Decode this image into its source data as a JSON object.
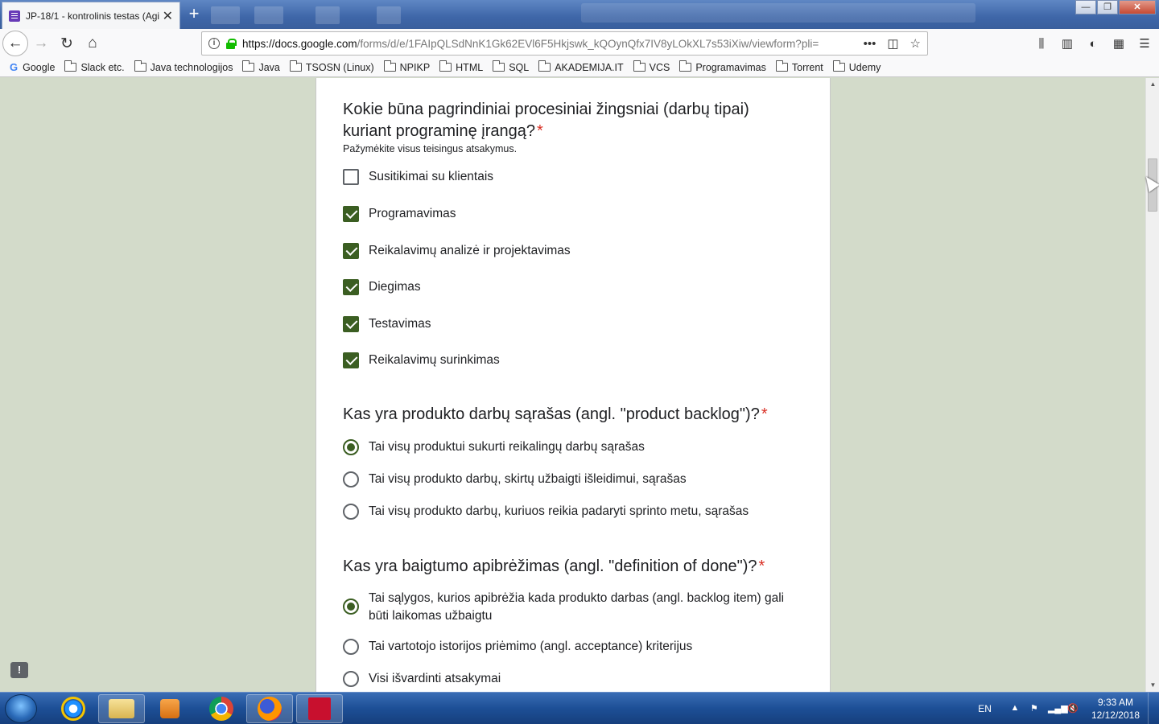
{
  "browser": {
    "tab_title": "JP-18/1 - kontrolinis testas (Agi",
    "tab_close": "✕",
    "new_tab": "+",
    "url_host": "https://docs.google.com",
    "url_path": "/forms/d/e/1FAIpQLSdNnK1Gk62EVl6F5Hkjswk_kQOynQfx7IV8yLOkXL7s53iXiw/viewform?pli=",
    "page_actions_icon": "•••"
  },
  "bookmarks": [
    {
      "label": "Google",
      "icon": "google-icon"
    },
    {
      "label": "Slack etc.",
      "icon": "folder-icon"
    },
    {
      "label": "Java technologijos",
      "icon": "folder-icon"
    },
    {
      "label": "Java",
      "icon": "folder-icon"
    },
    {
      "label": "TSOSN (Linux)",
      "icon": "folder-icon"
    },
    {
      "label": "NPIKP",
      "icon": "folder-icon"
    },
    {
      "label": "HTML",
      "icon": "folder-icon"
    },
    {
      "label": "SQL",
      "icon": "folder-icon"
    },
    {
      "label": "AKADEMIJA.IT",
      "icon": "folder-icon"
    },
    {
      "label": "VCS",
      "icon": "folder-icon"
    },
    {
      "label": "Programavimas",
      "icon": "folder-icon"
    },
    {
      "label": "Torrent",
      "icon": "folder-icon"
    },
    {
      "label": "Udemy",
      "icon": "folder-icon"
    }
  ],
  "form": {
    "required_mark": "*",
    "q1": {
      "title": "Kokie būna pagrindiniai procesiniai žingsniai (darbų tipai) kuriant programinę įrangą?",
      "hint": "Pažymėkite visus teisingus atsakymus.",
      "options": [
        {
          "label": "Susitikimai su klientais",
          "checked": false
        },
        {
          "label": "Programavimas",
          "checked": true
        },
        {
          "label": "Reikalavimų analizė ir projektavimas",
          "checked": true
        },
        {
          "label": "Diegimas",
          "checked": true
        },
        {
          "label": "Testavimas",
          "checked": true
        },
        {
          "label": "Reikalavimų surinkimas",
          "checked": true
        }
      ]
    },
    "q2": {
      "title": "Kas yra produkto darbų sąrašas (angl. \"product backlog\")?",
      "options": [
        {
          "label": "Tai visų produktui sukurti reikalingų darbų sąrašas",
          "selected": true
        },
        {
          "label": "Tai visų produkto darbų, skirtų užbaigti išleidimui, sąrašas",
          "selected": false
        },
        {
          "label": "Tai visų produkto darbų, kuriuos reikia padaryti sprinto metu, sąrašas",
          "selected": false
        }
      ]
    },
    "q3": {
      "title": "Kas yra baigtumo apibrėžimas (angl. \"definition of done\")?",
      "options": [
        {
          "label": "Tai sąlygos, kurios apibrėžia kada produkto darbas (angl. backlog item) gali būti laikomas užbaigtu",
          "selected": true
        },
        {
          "label": "Tai vartotojo istorijos priėmimo (angl. acceptance) kriterijus",
          "selected": false
        },
        {
          "label": "Visi išvardinti atsakymai",
          "selected": false
        }
      ]
    },
    "feedback_icon": "!"
  },
  "taskbar": {
    "language": "EN",
    "time": "9:33 AM",
    "date": "12/12/2018"
  },
  "colors": {
    "accent": "#3b5e22",
    "required": "#d93025",
    "page_background": "#d3dbca"
  }
}
